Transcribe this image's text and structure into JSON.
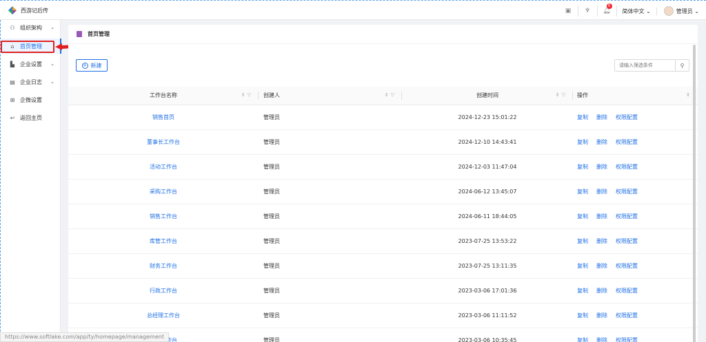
{
  "app": {
    "title": "西游记后传",
    "brand_colors": [
      "#2e7fd8",
      "#f5a623",
      "#8e44ad",
      "#27ae60"
    ]
  },
  "topbar": {
    "icons": [
      "document-icon",
      "shirt-icon",
      "bell-icon"
    ],
    "notification_count": "0",
    "language": "简体中文",
    "user": "管理员"
  },
  "sidebar": {
    "items": [
      {
        "label": "组织架构",
        "icon": "org-icon",
        "expandable": true
      },
      {
        "label": "首页管理",
        "icon": "home-icon",
        "active": true
      },
      {
        "label": "企业设置",
        "icon": "building-icon",
        "expandable": true
      },
      {
        "label": "企业日志",
        "icon": "log-icon",
        "expandable": true
      },
      {
        "label": "企微设置",
        "icon": "grid-icon"
      },
      {
        "label": "返回主页",
        "icon": "back-icon"
      }
    ]
  },
  "page": {
    "title": "首页管理"
  },
  "toolbar": {
    "new_label": "新建",
    "search_placeholder": "请输入筛选条件"
  },
  "table": {
    "headers": [
      "工作台名称",
      "创建人",
      "创建时间",
      "操作"
    ],
    "actions": [
      "复制",
      "删除",
      "权限配置"
    ],
    "rows": [
      {
        "name": "销售首页",
        "creator": "管理员",
        "time": "2024-12-23 15:01:22"
      },
      {
        "name": "董事长工作台",
        "creator": "管理员",
        "time": "2024-12-10 14:43:41"
      },
      {
        "name": "活动工作台",
        "creator": "管理员",
        "time": "2024-12-03 11:47:04"
      },
      {
        "name": "采购工作台",
        "creator": "管理员",
        "time": "2024-06-12 13:45:07"
      },
      {
        "name": "销售工作台",
        "creator": "管理员",
        "time": "2024-06-11 18:44:05"
      },
      {
        "name": "库管工作台",
        "creator": "管理员",
        "time": "2023-07-25 13:53:22"
      },
      {
        "name": "财务工作台",
        "creator": "管理员",
        "time": "2023-07-25 13:11:35"
      },
      {
        "name": "行政工作台",
        "creator": "管理员",
        "time": "2023-03-06 17:01:36"
      },
      {
        "name": "总经理工作台",
        "creator": "管理员",
        "time": "2023-03-06 11:11:52"
      },
      {
        "name": "财务工作台",
        "creator": "管理员",
        "time": "2023-03-06 10:35:45"
      }
    ]
  },
  "status_url": "https://www.softlake.com/app/ty/homepage/management"
}
